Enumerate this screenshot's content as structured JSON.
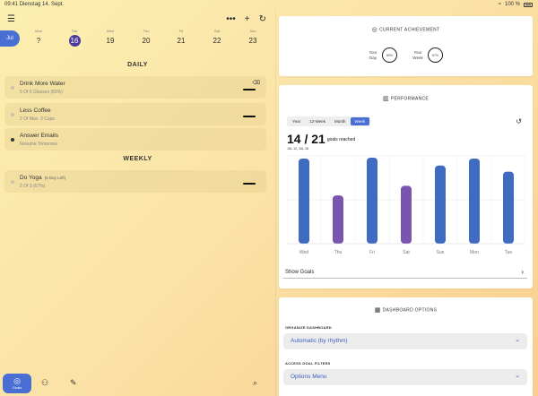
{
  "status": {
    "time": "09:41",
    "date": "Dienstag 14. Sept.",
    "battery": "100 %"
  },
  "left": {
    "month": "Jul",
    "days": [
      {
        "name": "Mon",
        "date": "?",
        "selected": false
      },
      {
        "name": "Tue",
        "date": "16",
        "selected": true
      },
      {
        "name": "Wed",
        "date": "19",
        "selected": false
      },
      {
        "name": "Thu",
        "date": "20",
        "selected": false
      },
      {
        "name": "Fri",
        "date": "21",
        "selected": false
      },
      {
        "name": "Sat",
        "date": "22",
        "selected": false
      },
      {
        "name": "Sun",
        "date": "23",
        "selected": false
      }
    ],
    "daily_title": "DAILY",
    "weekly_title": "WEEKLY",
    "tasks_daily": [
      {
        "title": "Drink More Water",
        "subtitle": "5 Of 6 Glasses (83%)",
        "done": false
      },
      {
        "title": "Less Coffee",
        "subtitle": "2 Of Max. 3 Cups",
        "done": false
      },
      {
        "title": "Answer Emails",
        "subtitle": "Resume Tomorrow",
        "done": true
      }
    ],
    "tasks_weekly": [
      {
        "title": "Do Yoga",
        "badge": "(6 Day Left)",
        "subtitle": "2 Of 3 (67%)",
        "done": false
      }
    ],
    "goals_label": "Goals"
  },
  "achievement": {
    "title": "CURRENT ACHIEVEMENT",
    "day_label": "Your Day",
    "day_value": "80%",
    "week_label": "Your Week",
    "week_value": "67%"
  },
  "performance": {
    "title": "PERFORMANCE",
    "segments": [
      "Year",
      "12-Week",
      "Month",
      "Week"
    ],
    "active_segment": "Week",
    "reached": "14 / 21",
    "reached_label": "goals reached",
    "range": "JUL 12, JUL 18",
    "show_goals": "Show Goals"
  },
  "options": {
    "title": "DASHBOARD OPTIONS",
    "organize_label": "ORGANIZE DASHBOARD",
    "organize_value": "Automatic (by rhythm)",
    "filters_label": "ACCESS GOAL FILTERS",
    "filters_value": "Options Menu"
  },
  "chart_data": {
    "type": "bar",
    "categories": [
      "Wed",
      "Thu",
      "Fri",
      "Sat",
      "Sun",
      "Mon",
      "Tue"
    ],
    "values": [
      0.97,
      0.55,
      0.98,
      0.66,
      0.89,
      0.97,
      0.82
    ],
    "colors": [
      "#3f6cc0",
      "#7a55b0",
      "#3f6cc0",
      "#7a55b0",
      "#3f6cc0",
      "#3f6cc0",
      "#3f6cc0"
    ],
    "ylim": [
      0,
      1
    ],
    "grid": true
  }
}
